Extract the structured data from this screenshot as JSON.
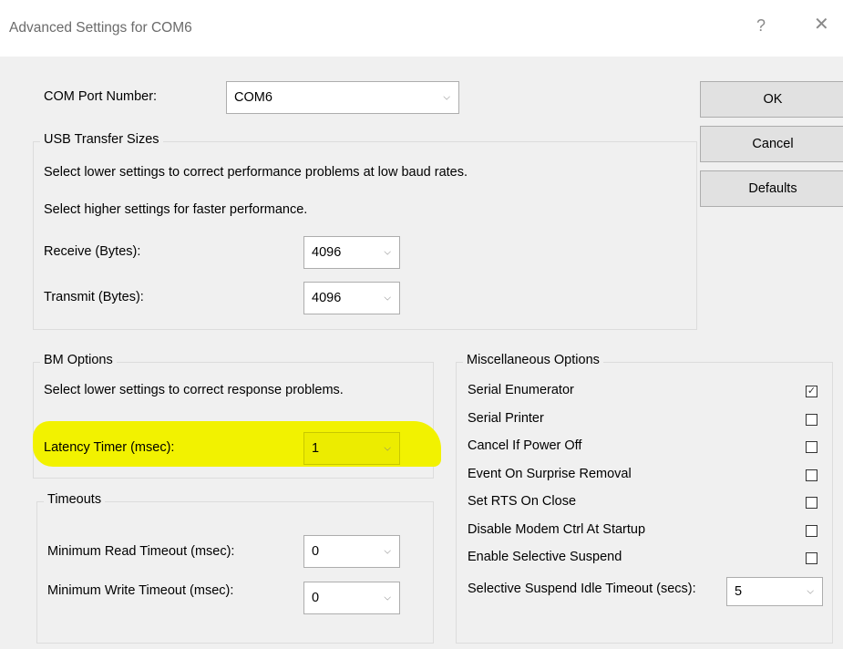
{
  "window": {
    "title": "Advanced Settings for COM6",
    "help_glyph": "?",
    "close_glyph": "✕"
  },
  "com_port": {
    "label": "COM Port Number:",
    "value": "COM6"
  },
  "buttons": {
    "ok": "OK",
    "cancel": "Cancel",
    "defaults": "Defaults"
  },
  "usb": {
    "title": "USB Transfer Sizes",
    "line1": "Select lower settings to correct performance problems at low baud rates.",
    "line2": "Select higher settings for faster performance.",
    "receive_label": "Receive (Bytes):",
    "receive_value": "4096",
    "transmit_label": "Transmit (Bytes):",
    "transmit_value": "4096"
  },
  "bm": {
    "title": "BM Options",
    "line1": "Select lower settings to correct response problems.",
    "latency_label": "Latency Timer (msec):",
    "latency_value": "1",
    "highlight_color": "#f2f200"
  },
  "timeouts": {
    "title": "Timeouts",
    "read_label": "Minimum Read Timeout (msec):",
    "read_value": "0",
    "write_label": "Minimum Write Timeout (msec):",
    "write_value": "0"
  },
  "misc": {
    "title": "Miscellaneous Options",
    "options": [
      {
        "label": "Serial Enumerator",
        "checked": true
      },
      {
        "label": "Serial Printer",
        "checked": false
      },
      {
        "label": "Cancel If Power Off",
        "checked": false
      },
      {
        "label": "Event On Surprise Removal",
        "checked": false
      },
      {
        "label": "Set RTS On Close",
        "checked": false
      },
      {
        "label": "Disable Modem Ctrl At Startup",
        "checked": false
      },
      {
        "label": "Enable Selective Suspend",
        "checked": false
      }
    ],
    "suspend_label": "Selective Suspend Idle Timeout (secs):",
    "suspend_value": "5"
  },
  "dropdown_glyph": "⌵",
  "check_glyph": "✓"
}
